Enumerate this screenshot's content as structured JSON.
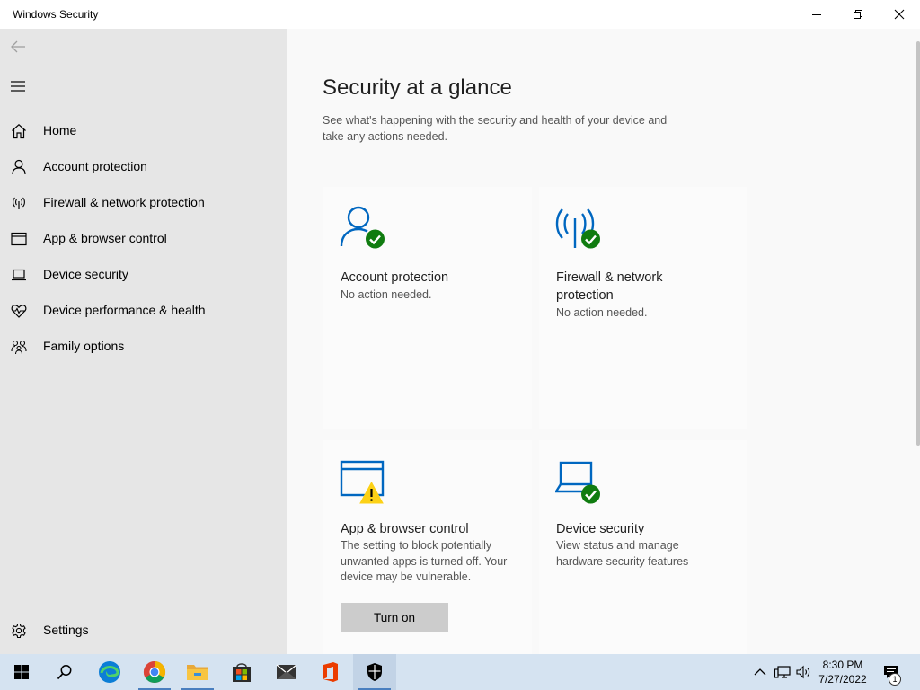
{
  "window": {
    "title": "Windows Security"
  },
  "sidebar": {
    "items": [
      {
        "label": "Home",
        "icon": "home-icon"
      },
      {
        "label": "Account protection",
        "icon": "person-icon"
      },
      {
        "label": "Firewall & network protection",
        "icon": "antenna-icon"
      },
      {
        "label": "App & browser control",
        "icon": "browser-window-icon"
      },
      {
        "label": "Device security",
        "icon": "laptop-icon"
      },
      {
        "label": "Device performance & health",
        "icon": "heart-icon"
      },
      {
        "label": "Family options",
        "icon": "family-icon"
      }
    ],
    "settings_label": "Settings"
  },
  "main": {
    "title": "Security at a glance",
    "subtitle": "See what's happening with the security and health of your device and take any actions needed.",
    "cards": [
      {
        "title": "Account protection",
        "status": "No action needed.",
        "icon": "person-check-icon",
        "status_color": "#107c10"
      },
      {
        "title": "Firewall & network protection",
        "status": "No action needed.",
        "icon": "antenna-check-icon",
        "status_color": "#107c10"
      },
      {
        "title": "App & browser control",
        "status": "The setting to block potentially unwanted apps is turned off. Your device may be vulnerable.",
        "icon": "browser-warning-icon",
        "status_color": "#fcd116",
        "action_label": "Turn on"
      },
      {
        "title": "Device security",
        "status": "View status and manage hardware security features",
        "icon": "laptop-check-icon",
        "status_color": "#107c10"
      }
    ]
  },
  "taskbar": {
    "apps": [
      "start-icon",
      "search-icon",
      "edge-icon",
      "chrome-icon",
      "file-explorer-icon",
      "microsoft-store-icon",
      "mail-icon",
      "office-icon",
      "windows-security-icon"
    ],
    "time": "8:30 PM",
    "date": "7/27/2022",
    "notification_count": "1"
  },
  "colors": {
    "accent": "#0067c0",
    "success": "#107c10",
    "warning": "#fcd116",
    "sidebar_bg": "#e6e6e6",
    "taskbar_bg": "#d5e3f1"
  }
}
